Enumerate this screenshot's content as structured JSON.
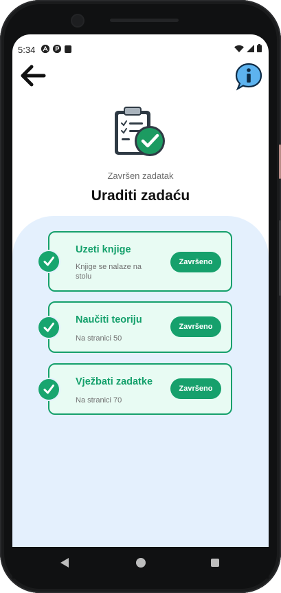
{
  "status_bar": {
    "time": "5:34"
  },
  "header": {
    "subtitle": "Završen zadatak",
    "title": "Uraditi zadaću"
  },
  "tasks": [
    {
      "title": "Uzeti knjige",
      "description": "Knjige se nalaze na stolu",
      "button_label": "Završeno"
    },
    {
      "title": "Naučiti teoriju",
      "description": "Na stranici 50",
      "button_label": "Završeno"
    },
    {
      "title": "Vježbati zadatke",
      "description": "Na stranici 70",
      "button_label": "Završeno"
    }
  ],
  "icons": {
    "back": "back-arrow-icon",
    "info": "info-icon",
    "clipboard": "clipboard-check-icon",
    "task_check": "check-icon"
  },
  "colors": {
    "accent": "#16a06c",
    "panel_bg": "#e4f0fd",
    "card_bg": "#e8fbf3"
  }
}
